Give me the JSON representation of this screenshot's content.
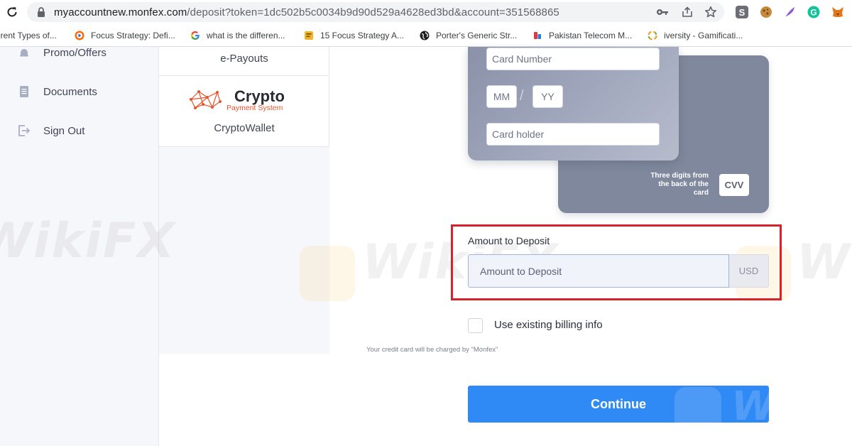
{
  "browser": {
    "url_host": "myaccountnew.monfex.com",
    "url_rest": "/deposit?token=1dc502b5c0034b9d90d529a4628ed3bd&account=351568865",
    "bookmarks": [
      {
        "label": "erent Types of...",
        "icon": "bookmark-icon"
      },
      {
        "label": "Focus Strategy: Defi...",
        "icon": "focus-strategy-favicon"
      },
      {
        "label": "what is the differen...",
        "icon": "google-icon"
      },
      {
        "label": "15 Focus Strategy A...",
        "icon": "document-favicon"
      },
      {
        "label": "Porter's Generic Str...",
        "icon": "globe-favicon"
      },
      {
        "label": "Pakistan Telecom M...",
        "icon": "telecom-favicon"
      },
      {
        "label": "iversity - Gamificati...",
        "icon": "iversity-favicon"
      }
    ]
  },
  "sidebar": {
    "items": [
      {
        "label": "Promo/Offers",
        "icon": "bell-icon"
      },
      {
        "label": "Documents",
        "icon": "document-icon"
      },
      {
        "label": "Sign Out",
        "icon": "sign-out-icon"
      }
    ]
  },
  "methods": {
    "epayouts_label": "e-Payouts",
    "crypto_logo_word": "Crypto",
    "crypto_logo_tagline": "Payment System",
    "crypto_label": "CryptoWallet"
  },
  "card": {
    "number_placeholder": "Card Number",
    "month_placeholder": "MM",
    "year_placeholder": "YY",
    "holder_placeholder": "Card holder",
    "cvv_hint": "Three digits from the back of the card",
    "cvv_label": "CVV"
  },
  "amount": {
    "label": "Amount to Deposit",
    "placeholder": "Amount to Deposit",
    "currency": "USD"
  },
  "billing": {
    "checkbox_label": "Use existing billing info",
    "checked": false
  },
  "charge_note": "Your credit card will be charged by \"Monfex\"",
  "continue_label": "Continue",
  "watermark": "WikiFX",
  "colors": {
    "primary_button": "#2f8af5",
    "highlight_box": "#d4232a",
    "crypto_accent": "#e8542d"
  }
}
